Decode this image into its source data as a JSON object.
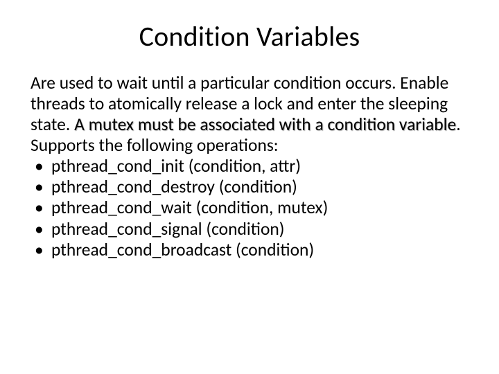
{
  "title": "Condition Variables",
  "intro_part1": "Are used to wait until a particular condition occurs. Enable threads to atomically release a lock and enter the sleeping state. ",
  "intro_emph": "A mutex must be associated with a condition variable",
  "intro_part2": ". Supports the following operations:",
  "bullets": [
    "pthread_cond_init (condition, attr)",
    "pthread_cond_destroy (condition)",
    "pthread_cond_wait (condition, mutex)",
    "pthread_cond_signal (condition)",
    "pthread_cond_broadcast (condition)"
  ]
}
